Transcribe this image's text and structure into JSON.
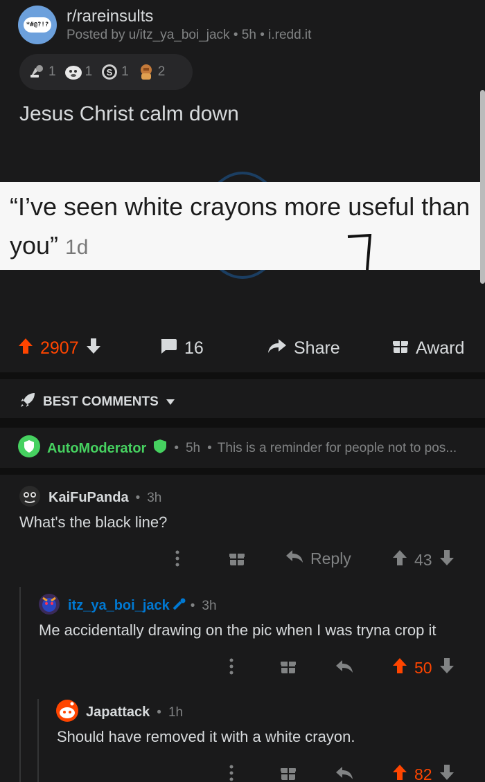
{
  "post": {
    "subreddit": "r/rareinsults",
    "posted_by": "Posted by u/itz_ya_boi_jack",
    "age": "5h",
    "domain": "i.redd.it",
    "title": "Jesus Christ calm down",
    "image_quote": "“I’ve seen white crayons more useful than you”",
    "image_quote_age": "1d",
    "avatar_text": "*#@?!?"
  },
  "awards": [
    {
      "icon": "rocket-like-award-icon",
      "count": "1"
    },
    {
      "icon": "mind-blown-award-icon",
      "count": "1"
    },
    {
      "icon": "silver-award-icon",
      "count": "1"
    },
    {
      "icon": "face-palm-award-icon",
      "count": "2"
    }
  ],
  "actions": {
    "score": "2907",
    "comments": "16",
    "share": "Share",
    "award": "Award"
  },
  "sort_label": "BEST COMMENTS",
  "pinned": {
    "author": "AutoModerator",
    "age": "5h",
    "preview": "This is a reminder for people not to pos..."
  },
  "comments": [
    {
      "author": "KaiFuPanda",
      "age": "3h",
      "text": "What's the black line?",
      "reply": "Reply",
      "score": "43"
    },
    {
      "author": "itz_ya_boi_jack",
      "age": "3h",
      "text": "Me accidentally drawing on the pic when I was tryna crop it",
      "score": "50"
    },
    {
      "author": "Japattack",
      "age": "1h",
      "text": "Should have removed it with a white crayon.",
      "score": "82"
    }
  ],
  "colors": {
    "upvoted": "#ff4500",
    "mod_green": "#46d160",
    "op_blue": "#0079d3",
    "background": "#1a1a1b"
  }
}
